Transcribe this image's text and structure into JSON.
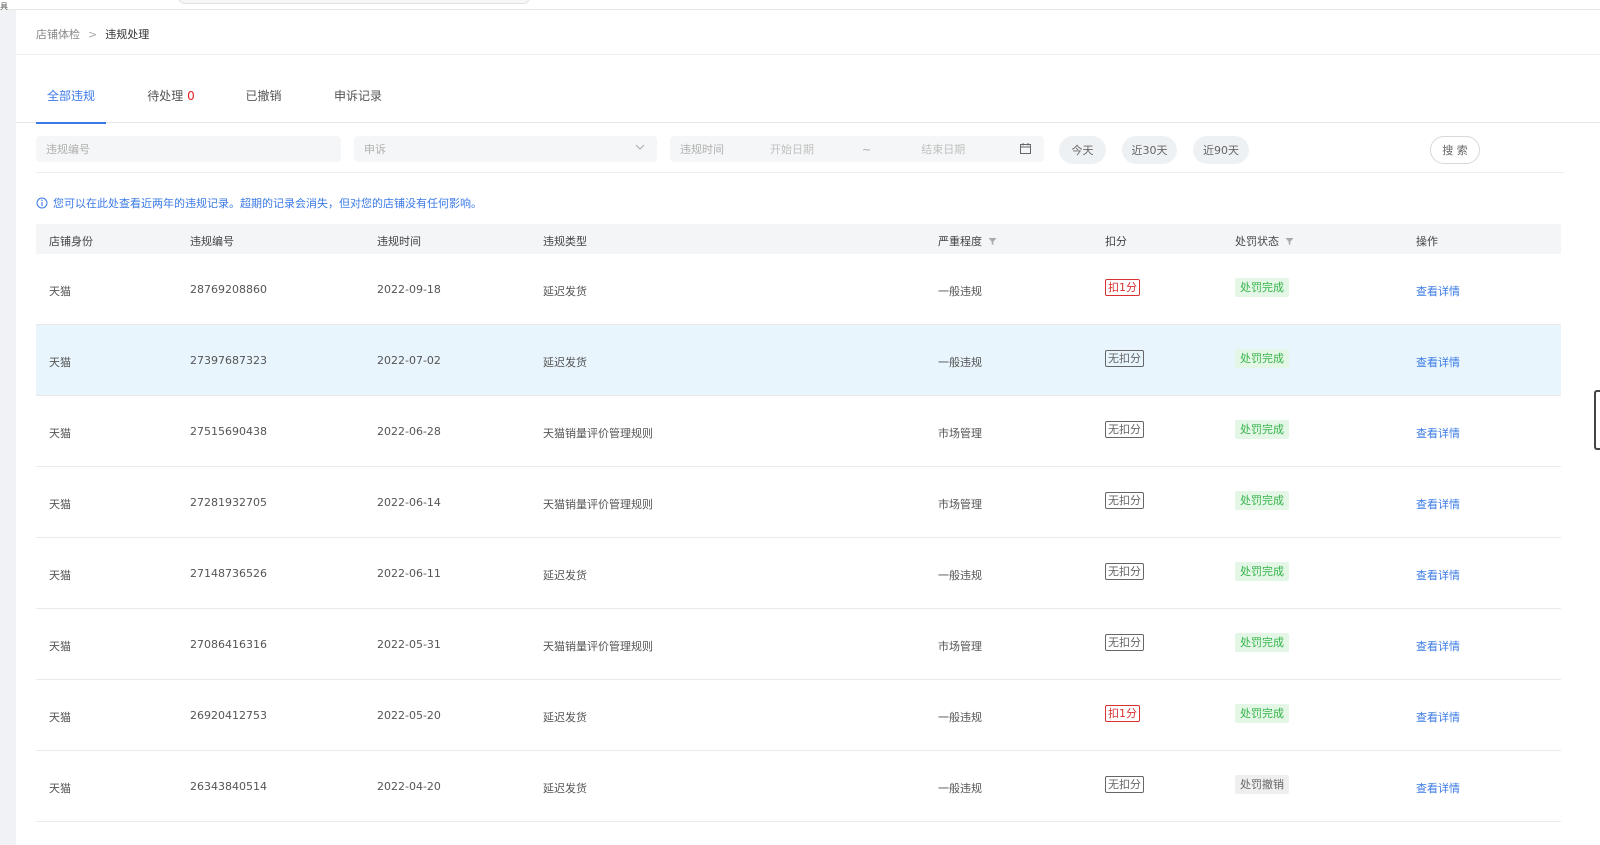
{
  "top": {
    "corner_mark": "具"
  },
  "breadcrumb": {
    "parent": "店铺体检",
    "separator": ">",
    "current": "违规处理"
  },
  "tabs": [
    {
      "label": "全部违规",
      "badge": ""
    },
    {
      "label": "待处理",
      "badge": "0"
    },
    {
      "label": "已撤销",
      "badge": ""
    },
    {
      "label": "申诉记录",
      "badge": ""
    }
  ],
  "filters": {
    "violation_no_placeholder": "违规编号",
    "appeal_select_value": "申诉",
    "time_label": "违规时间",
    "start_placeholder": "开始日期",
    "range_sep": "~",
    "end_placeholder": "结束日期",
    "quick_today": "今天",
    "quick_30": "近30天",
    "quick_90": "近90天",
    "search_label": "搜 索"
  },
  "notice": "您可以在此处查看近两年的违规记录。超期的记录会消失，但对您的店铺没有任何影响。",
  "columns": [
    "店铺身份",
    "违规编号",
    "违规时间",
    "违规类型",
    "严重程度",
    "扣分",
    "处罚状态",
    "操作"
  ],
  "rows": [
    {
      "identity": "天猫",
      "id": "28769208860",
      "date": "2022-09-18",
      "type": "延迟发货",
      "severity": "一般违规",
      "points": "扣1分",
      "points_style": "red",
      "status": "处罚完成",
      "status_style": "green",
      "action": "查看详情"
    },
    {
      "identity": "天猫",
      "id": "27397687323",
      "date": "2022-07-02",
      "type": "延迟发货",
      "severity": "一般违规",
      "points": "无扣分",
      "points_style": "gray",
      "status": "处罚完成",
      "status_style": "green",
      "action": "查看详情"
    },
    {
      "identity": "天猫",
      "id": "27515690438",
      "date": "2022-06-28",
      "type": "天猫销量评价管理规则",
      "severity": "市场管理",
      "points": "无扣分",
      "points_style": "gray",
      "status": "处罚完成",
      "status_style": "green",
      "action": "查看详情"
    },
    {
      "identity": "天猫",
      "id": "27281932705",
      "date": "2022-06-14",
      "type": "天猫销量评价管理规则",
      "severity": "市场管理",
      "points": "无扣分",
      "points_style": "gray",
      "status": "处罚完成",
      "status_style": "green",
      "action": "查看详情"
    },
    {
      "identity": "天猫",
      "id": "27148736526",
      "date": "2022-06-11",
      "type": "延迟发货",
      "severity": "一般违规",
      "points": "无扣分",
      "points_style": "gray",
      "status": "处罚完成",
      "status_style": "green",
      "action": "查看详情"
    },
    {
      "identity": "天猫",
      "id": "27086416316",
      "date": "2022-05-31",
      "type": "天猫销量评价管理规则",
      "severity": "市场管理",
      "points": "无扣分",
      "points_style": "gray",
      "status": "处罚完成",
      "status_style": "green",
      "action": "查看详情"
    },
    {
      "identity": "天猫",
      "id": "26920412753",
      "date": "2022-05-20",
      "type": "延迟发货",
      "severity": "一般违规",
      "points": "扣1分",
      "points_style": "red",
      "status": "处罚完成",
      "status_style": "green",
      "action": "查看详情"
    },
    {
      "identity": "天猫",
      "id": "26343840514",
      "date": "2022-04-20",
      "type": "延迟发货",
      "severity": "一般违规",
      "points": "无扣分",
      "points_style": "gray",
      "status": "处罚撤销",
      "status_style": "grey",
      "action": "查看详情"
    }
  ],
  "colors": {
    "accent": "#3b7ae6",
    "danger": "#d93030",
    "success": "#35b34a",
    "row_highlight": "#e8f5fc"
  },
  "icons": {
    "info": "info-circle-icon",
    "chevron": "chevron-down-icon",
    "calendar": "calendar-icon",
    "filter": "filter-funnel-icon"
  }
}
